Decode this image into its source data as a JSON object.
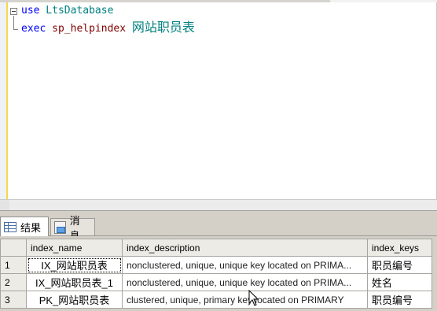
{
  "editor": {
    "lines": [
      {
        "keyword": "use",
        "rest": " LtsDatabase"
      },
      {
        "keyword": "exec",
        "proc": " sp_helpindex ",
        "arg": "网站职员表"
      }
    ]
  },
  "tabs": [
    {
      "label": "结果",
      "icon": "grid-icon"
    },
    {
      "label": "消息",
      "icon": "message-icon"
    }
  ],
  "grid": {
    "columns": [
      "index_name",
      "index_description",
      "index_keys"
    ],
    "rows": [
      {
        "num": "1",
        "index_name": "IX_网站职员表",
        "index_description": "nonclustered, unique, unique key located on PRIMA...",
        "index_keys": "职员编号"
      },
      {
        "num": "2",
        "index_name": "IX_网站职员表_1",
        "index_description": "nonclustered, unique, unique key located on PRIMA...",
        "index_keys": "姓名"
      },
      {
        "num": "3",
        "index_name": "PK_网站职员表",
        "index_description": "clustered, unique, primary key located on PRIMARY",
        "index_keys": "职员编号"
      }
    ]
  },
  "colors": {
    "keyword": "#0000ff",
    "identifier": "#008080",
    "procedure": "#800000"
  }
}
